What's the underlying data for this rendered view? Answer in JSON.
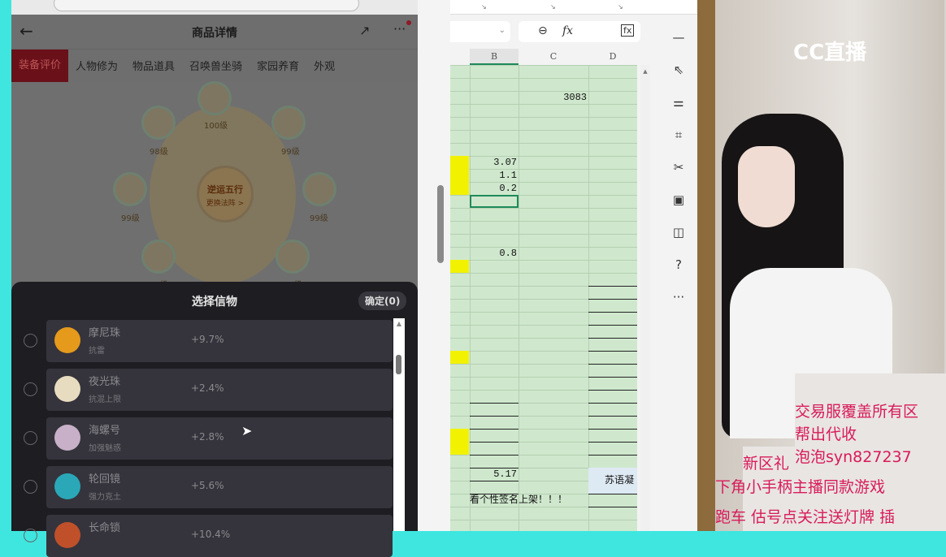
{
  "phone": {
    "header": {
      "title": "商品详情",
      "back_icon": "←",
      "share_icon": "↗",
      "more_icon": "···"
    },
    "tabs": [
      "装备评价",
      "人物修为",
      "物品道具",
      "召唤兽坐骑",
      "家园养育",
      "外观"
    ],
    "wheel": {
      "center_title": "逆运五行",
      "center_sub": "更换法阵 >",
      "levels": [
        "100级",
        "99级",
        "99级",
        "98级",
        "98级",
        "99级",
        "98级",
        "99级"
      ]
    },
    "sheet": {
      "title": "选择信物",
      "confirm": "确定(0)",
      "items": [
        {
          "name": "摩尼珠",
          "attr": "抗雷",
          "pct": "+9.7%",
          "color": "#e59a1c"
        },
        {
          "name": "夜光珠",
          "attr": "抗混上限",
          "pct": "+2.4%",
          "color": "#e8dcc0"
        },
        {
          "name": "海螺号",
          "attr": "加强魅惑",
          "pct": "+2.8%",
          "color": "#c8b0c8"
        },
        {
          "name": "轮回镜",
          "attr": "强力克土",
          "pct": "+5.6%",
          "color": "#2aa8b8"
        },
        {
          "name": "长命锁",
          "attr": "",
          "pct": "+10.4%",
          "color": "#c0502a"
        }
      ]
    }
  },
  "excel": {
    "columns": [
      "B",
      "C",
      "D"
    ],
    "cells": [
      {
        "row": 2,
        "col": "C",
        "value": "3083"
      },
      {
        "row": 7,
        "col": "B",
        "value": "3.07"
      },
      {
        "row": 8,
        "col": "B",
        "value": "1.1"
      },
      {
        "row": 9,
        "col": "B",
        "value": "0.2"
      },
      {
        "row": 14,
        "col": "B",
        "value": "0.8"
      },
      {
        "row": 31,
        "col": "B",
        "value": "5.17"
      },
      {
        "row": 31,
        "col": "D",
        "value": "苏语凝"
      },
      {
        "row": 33,
        "col": "B",
        "value": "看个性签名上架！！！"
      }
    ],
    "yellow_rows": [
      7,
      8,
      9,
      15,
      22,
      28,
      29
    ],
    "selected": {
      "row": 10,
      "col": "B"
    },
    "fx_label": "fx"
  },
  "stream": {
    "logo": "CC直播",
    "ads": [
      "交易服覆盖所有区",
      "帮出代收",
      "泡泡syn827237",
      "新区礼",
      "下角小手柄主播同款游戏",
      "跑车   估号点关注送灯牌 插"
    ]
  }
}
